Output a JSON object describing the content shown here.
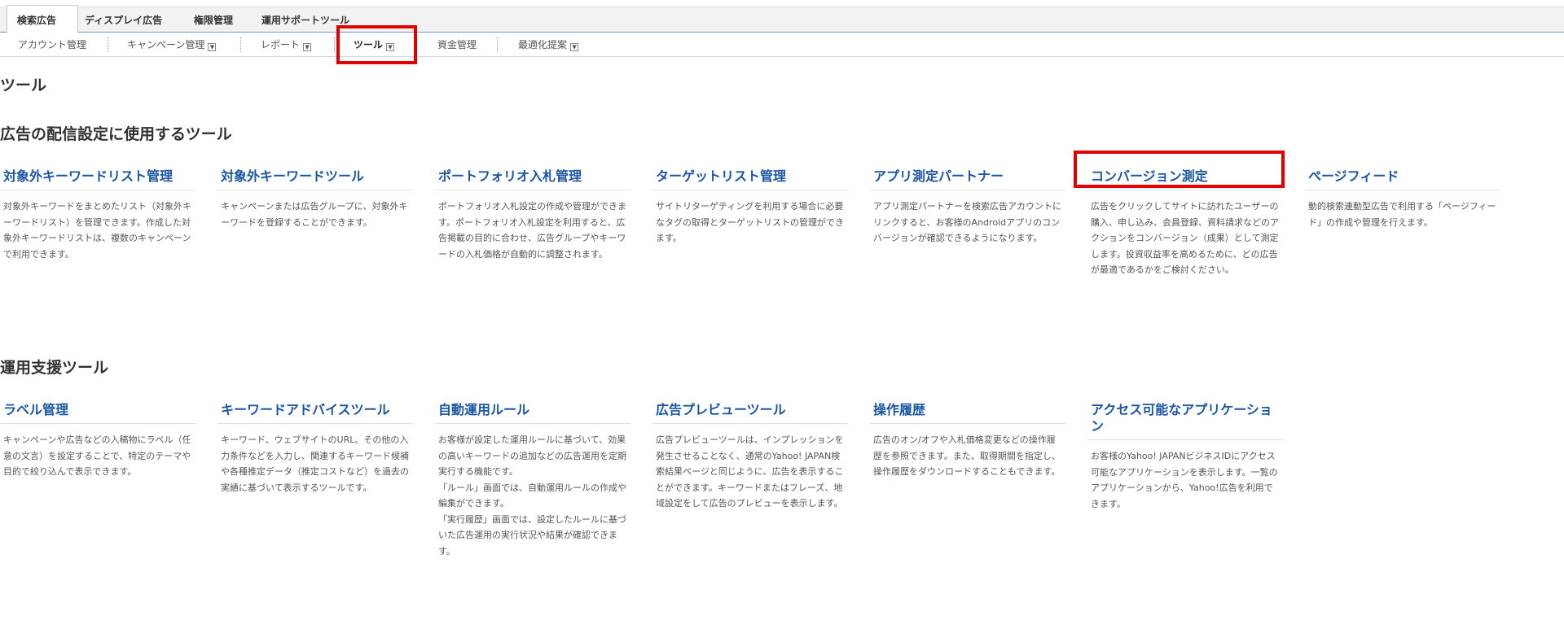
{
  "top_tabs": [
    {
      "label": "検索広告"
    },
    {
      "label": "ディスプレイ広告"
    },
    {
      "label": "権限管理"
    },
    {
      "label": "運用サポートツール"
    }
  ],
  "sub_nav": [
    {
      "label": "アカウント管理"
    },
    {
      "label": "キャンペーン管理"
    },
    {
      "label": "レポート"
    },
    {
      "label": "ツール"
    },
    {
      "label": "資金管理"
    },
    {
      "label": "最適化提案"
    }
  ],
  "dropdown_glyph": "▼",
  "page_title": "ツール",
  "sections": [
    {
      "title": "広告の配信設定に使用するツール",
      "tools": [
        {
          "title": "対象外キーワードリスト管理",
          "desc": "対象外キーワードをまとめたリスト（対象外キーワードリスト）を管理できます。作成した対象外キーワードリストは、複数のキャンペーンで利用できます。"
        },
        {
          "title": "対象外キーワードツール",
          "desc": "キャンペーンまたは広告グループに、対象外キーワードを登録することができます。"
        },
        {
          "title": "ポートフォリオ入札管理",
          "desc": "ポートフォリオ入札設定の作成や管理ができます。ポートフォリオ入札設定を利用すると、広告掲載の目的に合わせ、広告グループやキーワードの入札価格が自動的に調整されます。"
        },
        {
          "title": "ターゲットリスト管理",
          "desc": "サイトリターゲティングを利用する場合に必要なタグの取得とターゲットリストの管理ができます。"
        },
        {
          "title": "アプリ測定パートナー",
          "desc": "アプリ測定パートナーを検索広告アカウントにリンクすると、お客様のAndroidアプリのコンバージョンが確認できるようになります。"
        },
        {
          "title": "コンバージョン測定",
          "desc": "広告をクリックしてサイトに訪れたユーザーの購入、申し込み、会員登録、資料請求などのアクションをコンバージョン（成果）として測定します。投資収益率を高めるために、どの広告が最適であるかをご検討ください。"
        },
        {
          "title": "ページフィード",
          "desc": "動的検索連動型広告で利用する「ページフィード」の作成や管理を行えます。"
        }
      ]
    },
    {
      "title": "運用支援ツール",
      "tools": [
        {
          "title": "ラベル管理",
          "desc": "キャンペーンや広告などの入稿物にラベル（任意の文言）を設定することで、特定のテーマや目的で絞り込んで表示できます。"
        },
        {
          "title": "キーワードアドバイスツール",
          "desc": "キーワード、ウェブサイトのURL、その他の入力条件などを入力し、関連するキーワード候補や各種推定データ（推定コストなど）を過去の実績に基づいて表示するツールです。"
        },
        {
          "title": "自動運用ルール",
          "desc": "お客様が設定した運用ルールに基づいて、効果の高いキーワードの追加などの広告運用を定期実行する機能です。\n「ルール」画面では、自動運用ルールの作成や編集ができます。\n「実行履歴」画面では、設定したルールに基づいた広告運用の実行状況や結果が確認できます。"
        },
        {
          "title": "広告プレビューツール",
          "desc": "広告プレビューツールは、インプレッションを発生させることなく、通常のYahoo! JAPAN検索結果ページと同じように、広告を表示することができます。キーワードまたはフレーズ、地域設定をして広告のプレビューを表示します。"
        },
        {
          "title": "操作履歴",
          "desc": "広告のオン/オフや入札価格変更などの操作履歴を参照できます。また、取得期間を指定し、操作履歴をダウンロードすることもできます。"
        },
        {
          "title": "アクセス可能なアプリケーション",
          "desc": "お客様のYahoo! JAPANビジネスIDにアクセス可能なアプリケーションを表示します。一覧のアプリケーションから、Yahoo!広告を利用できます。"
        }
      ]
    }
  ],
  "colors": {
    "link": "#1a56a6",
    "highlight": "#e20000",
    "tab_border": "#6f95c2"
  }
}
